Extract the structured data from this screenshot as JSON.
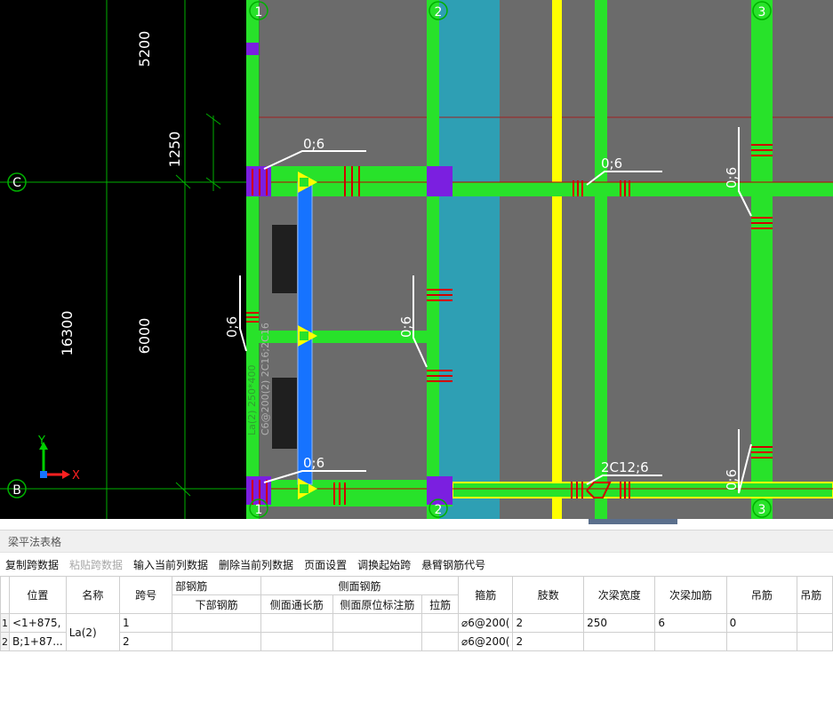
{
  "drawing": {
    "axis_top": [
      "1",
      "2",
      "3"
    ],
    "axis_bottom": [
      "1",
      "2",
      "3"
    ],
    "axis_left": [
      "C",
      "B"
    ],
    "dim_5200": "5200",
    "dim_1250": "1250",
    "dim_6000": "6000",
    "dim_16300": "16300",
    "label_06": "0;6",
    "label_2c12": "2C12;6",
    "beam_annotation_1": "La(2) 250*400",
    "beam_annotation_2": "C6@200(2) 2C16;2C16",
    "ucs_y": "Y",
    "ucs_x": "X",
    "colors": {
      "beam": "#28e22a",
      "column": "#7b1fe0",
      "selected_beam": "#1673ff",
      "highlight_band": "#2e9fb4",
      "yellow_beam": "#ffff00",
      "rebar": "#d00000",
      "grid_line": "#00a000",
      "slab": "#6b6b6b"
    }
  },
  "panel": {
    "title": "梁平法表格",
    "toolbar": [
      {
        "label": "复制跨数据",
        "enabled": true
      },
      {
        "label": "粘贴跨数据",
        "enabled": false
      },
      {
        "label": "输入当前列数据",
        "enabled": true
      },
      {
        "label": "删除当前列数据",
        "enabled": true
      },
      {
        "label": "页面设置",
        "enabled": true
      },
      {
        "label": "调换起始跨",
        "enabled": true
      },
      {
        "label": "悬臂钢筋代号",
        "enabled": true
      }
    ],
    "headers": {
      "position": "位置",
      "name": "名称",
      "span": "跨号",
      "bottom_group": "部钢筋",
      "bottom_rebar": "下部钢筋",
      "side_group": "侧面钢筋",
      "side_through": "侧面通长筋",
      "side_original": "侧面原位标注筋",
      "tie": "拉筋",
      "stirrup": "箍筋",
      "legs": "肢数",
      "sec_beam_width": "次梁宽度",
      "sec_beam_add": "次梁加筋",
      "hanger": "吊筋",
      "hanger2": "吊筋"
    },
    "rows": [
      {
        "num": "1",
        "position": "<1+875,",
        "name": "La(2)",
        "span": "1",
        "stirrup": "⌀6@200(",
        "legs": "2",
        "sec_beam_width": "250",
        "sec_beam_add": "6",
        "hanger": "0"
      },
      {
        "num": "2",
        "position": "B;1+87...",
        "span": "2",
        "stirrup": "⌀6@200(",
        "legs": "2"
      }
    ]
  }
}
